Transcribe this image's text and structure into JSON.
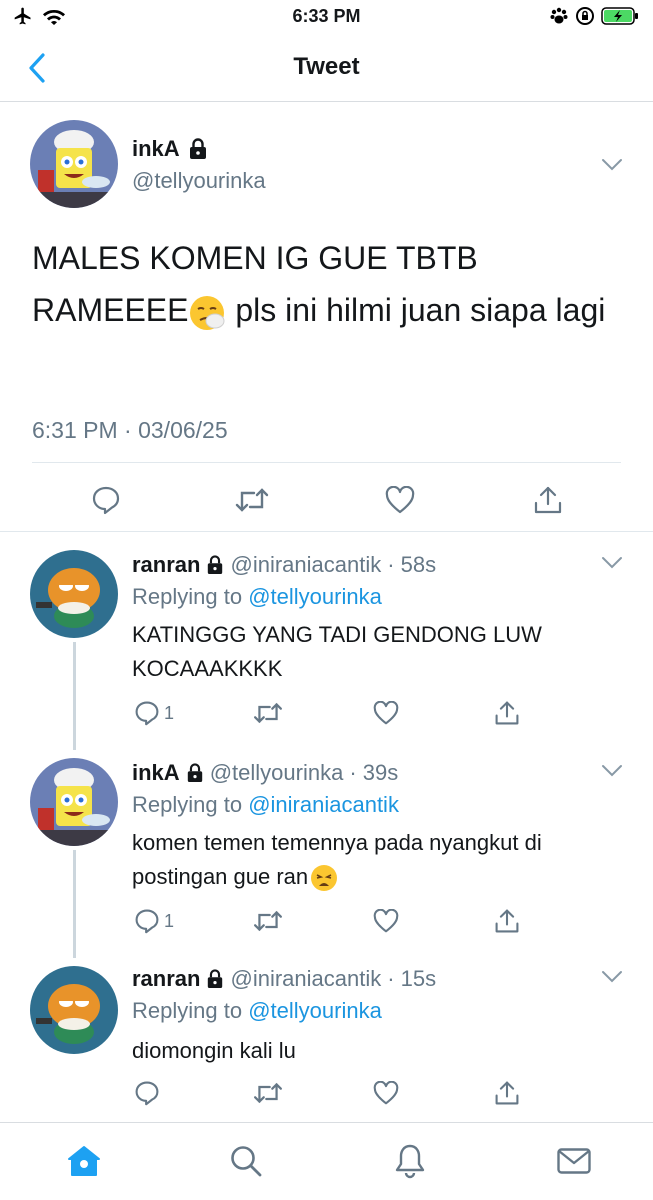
{
  "status_bar": {
    "time": "6:33 PM"
  },
  "nav": {
    "title": "Tweet"
  },
  "main_tweet": {
    "name": "inkA",
    "handle": "@tellyourinka",
    "text_part1": "MALES KOMEN IG GUE TBTB RAMEEEE",
    "text_part2": " pls ini hilmi juan siapa lagi",
    "timestamp": "6:31 PM · 03/06/25"
  },
  "replies": [
    {
      "name": "ranran",
      "handle": "@iniraniacantik",
      "time": "· 58s",
      "replying_prefix": "Replying to",
      "replying_to": "@tellyourinka",
      "text": "KATINGGG YANG TADI GENDONG LUW KOCAAAKKKK",
      "reply_count": "1"
    },
    {
      "name": "inkA",
      "handle": "@tellyourinka",
      "time": "· 39s",
      "replying_prefix": "Replying to",
      "replying_to": "@iniraniacantik",
      "text": "komen temen temennya pada nyangkut di postingan gue ran",
      "reply_count": "1"
    },
    {
      "name": "ranran",
      "handle": "@iniraniacantik",
      "time": "· 15s",
      "replying_prefix": "Replying to",
      "replying_to": "@tellyourinka",
      "text": "diomongin kali lu",
      "reply_count": ""
    }
  ],
  "colors": {
    "accent": "#1da1f2",
    "mention": "#1b95e0",
    "secondary_text": "#657786",
    "icon_gray": "#657786",
    "battery": "#4cd964"
  },
  "icons": {
    "status": [
      "airplane-icon",
      "wifi-icon",
      "paw-icon",
      "rotation-lock-icon",
      "battery-charging-icon"
    ],
    "actions": [
      "reply-icon",
      "retweet-icon",
      "like-icon",
      "share-icon"
    ],
    "tabs": [
      "home-icon",
      "search-icon",
      "notifications-icon",
      "messages-icon"
    ]
  }
}
